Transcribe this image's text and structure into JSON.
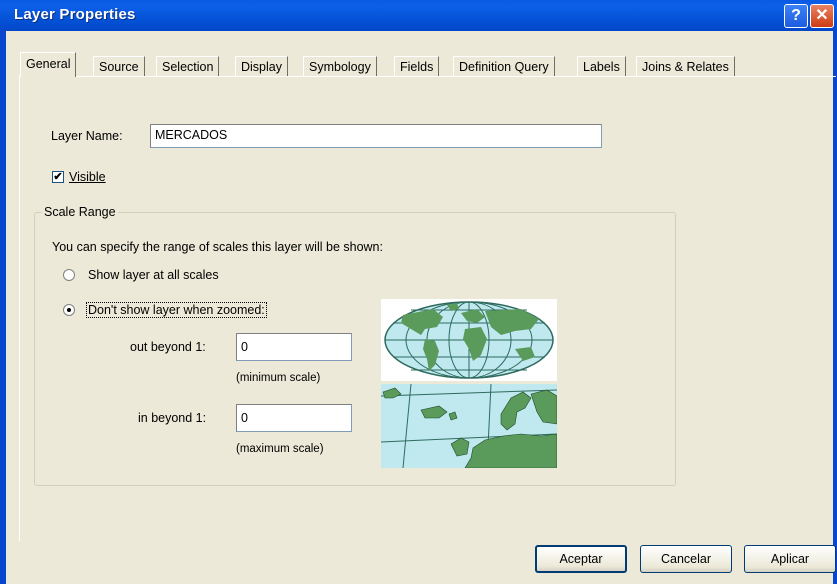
{
  "window": {
    "title": "Layer Properties",
    "help_glyph": "?",
    "close_glyph": "✕"
  },
  "tabs": [
    {
      "label": "General"
    },
    {
      "label": "Source"
    },
    {
      "label": "Selection"
    },
    {
      "label": "Display"
    },
    {
      "label": "Symbology"
    },
    {
      "label": "Fields"
    },
    {
      "label": "Definition Query"
    },
    {
      "label": "Labels"
    },
    {
      "label": "Joins & Relates"
    }
  ],
  "general": {
    "layer_name_label": "Layer Name:",
    "layer_name_value": "MERCADOS",
    "visible_label": "Visible",
    "visible_checked": true,
    "scale_range": {
      "title": "Scale Range",
      "description": "You can specify the range of scales this layer will be shown:",
      "option_all": "Show layer at all scales",
      "option_zoomed": "Don't show layer when zoomed:",
      "selected": "zoomed",
      "out_beyond_label": "out beyond  1:",
      "out_beyond_value": "0",
      "min_scale_note": "(minimum scale)",
      "in_beyond_label": "in beyond  1:",
      "in_beyond_value": "0",
      "max_scale_note": "(maximum scale)"
    }
  },
  "buttons": {
    "ok": "Aceptar",
    "cancel": "Cancelar",
    "apply": "Aplicar"
  },
  "colors": {
    "title_bar": "#0553d8",
    "dialog_bg": "#ece9d8",
    "map_land": "#5a9a5a",
    "map_sea": "#bfe8ef"
  },
  "icons": {
    "check": "✔"
  }
}
